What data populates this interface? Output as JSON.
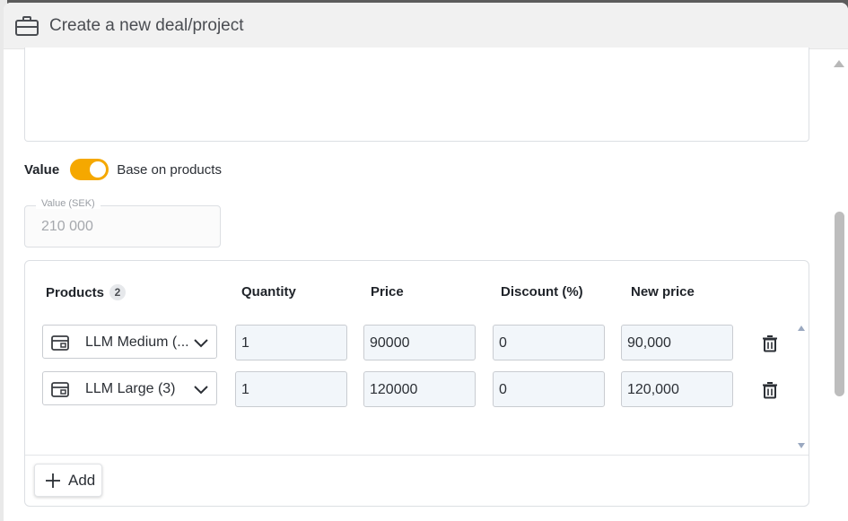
{
  "dialog": {
    "title": "Create a new deal/project",
    "header_icon": "briefcase-icon"
  },
  "value_section": {
    "label": "Value",
    "toggle_label": "Base on products",
    "toggle_on": true,
    "toggle_color": "#f5a800",
    "value_field": {
      "label": "Value (SEK)",
      "value": "210 000"
    }
  },
  "products": {
    "headers": {
      "products": "Products",
      "count": "2",
      "quantity": "Quantity",
      "price": "Price",
      "discount": "Discount (%)",
      "new_price": "New price"
    },
    "rows": [
      {
        "product": "LLM Medium (...",
        "quantity": "1",
        "price": "90000",
        "discount": "0",
        "new_price": "90,000"
      },
      {
        "product": "LLM Large (3)",
        "quantity": "1",
        "price": "120000",
        "discount": "0",
        "new_price": "120,000"
      }
    ],
    "add_label": "Add"
  }
}
